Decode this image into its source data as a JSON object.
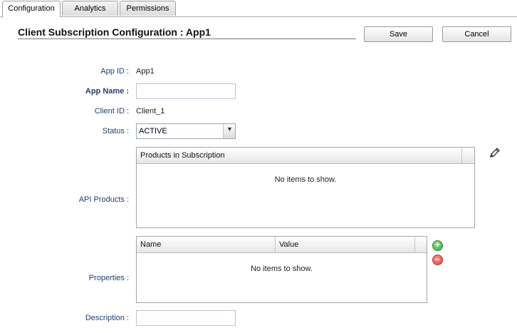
{
  "tabs": [
    {
      "label": "Configuration",
      "active": true
    },
    {
      "label": "Analytics",
      "active": false
    },
    {
      "label": "Permissions",
      "active": false
    }
  ],
  "header": {
    "title": "Client Subscription Configuration : App1",
    "save_label": "Save",
    "cancel_label": "Cancel"
  },
  "form": {
    "app_id_label": "App ID :",
    "app_id_value": "App1",
    "app_name_label": "App Name :",
    "app_name_value": "",
    "client_id_label": "Client ID :",
    "client_id_value": "Client_1",
    "status_label": "Status :",
    "status_value": "ACTIVE",
    "api_products_label": "API Products :",
    "products_grid": {
      "columns": [
        "Products in Subscription"
      ],
      "empty_text": "No items to show."
    },
    "properties_label": "Properties :",
    "properties_grid": {
      "columns": [
        "Name",
        "Value"
      ],
      "empty_text": "No items to show."
    },
    "description_label": "Description :",
    "description_value": ""
  },
  "icons": {
    "edit": "pencil-icon",
    "add": "plus-circle-icon",
    "remove": "minus-circle-icon"
  },
  "colors": {
    "label": "#1f3f6f",
    "add_green": "#3aa63a",
    "remove_red": "#d9403a"
  }
}
